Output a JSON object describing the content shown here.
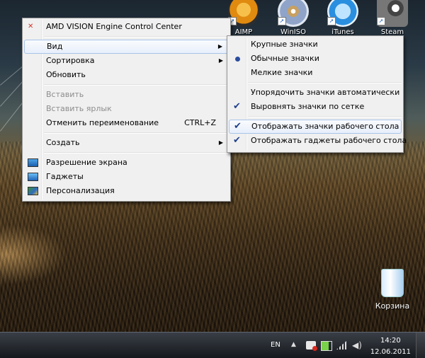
{
  "desktop": {
    "icons": [
      {
        "label": "AIMP",
        "icon": "aimp-icon",
        "color": "#f3a21a"
      },
      {
        "label": "WinISO",
        "icon": "disc-icon",
        "color": "#b8c2d8"
      },
      {
        "label": "iTunes",
        "icon": "itunes-icon",
        "color": "#2b8fe0"
      },
      {
        "label": "Steam",
        "icon": "steam-icon",
        "color": "#7c7f85"
      }
    ],
    "recycle_bin_label": "Корзина"
  },
  "context_menu": {
    "items": [
      {
        "label": "AMD VISION Engine Control Center",
        "icon": "amd-icon"
      },
      {
        "label": "Вид",
        "submenu": true
      },
      {
        "label": "Сортировка",
        "submenu": true
      },
      {
        "label": "Обновить"
      },
      {
        "label": "Вставить",
        "disabled": true
      },
      {
        "label": "Вставить ярлык",
        "disabled": true
      },
      {
        "label": "Отменить переименование",
        "shortcut": "CTRL+Z"
      },
      {
        "label": "Создать",
        "submenu": true
      },
      {
        "label": "Разрешение экрана",
        "icon": "display-icon"
      },
      {
        "label": "Гаджеты",
        "icon": "gadgets-icon"
      },
      {
        "label": "Персонализация",
        "icon": "personalize-icon"
      }
    ]
  },
  "view_submenu": {
    "items": [
      {
        "label": "Крупные значки"
      },
      {
        "label": "Обычные значки",
        "selected": true
      },
      {
        "label": "Мелкие значки"
      },
      {
        "label": "Упорядочить значки автоматически"
      },
      {
        "label": "Выровнять значки по сетке",
        "checked": true
      },
      {
        "label": "Отображать значки рабочего стола",
        "checked": true
      },
      {
        "label": "Отображать гаджеты  рабочего стола",
        "checked": true
      }
    ]
  },
  "taskbar": {
    "language": "EN",
    "time": "14:20",
    "date": "12.06.2011"
  },
  "colors": {
    "menu_bg": "#f0f0f0",
    "highlight_border": "#a8c4e8",
    "taskbar": "#1d2126"
  }
}
